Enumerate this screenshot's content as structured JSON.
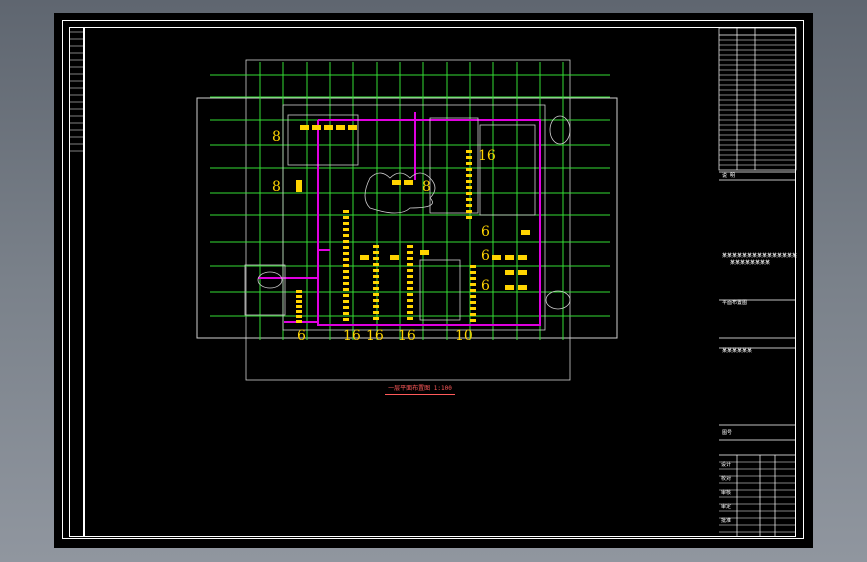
{
  "drawing": {
    "caption": "一层平面布置图 1:100",
    "zone_numbers_top": [
      "8",
      "8",
      "8",
      "16",
      "6",
      "6",
      "6"
    ],
    "zone_numbers_bottom": [
      "6",
      "16",
      "16",
      "16",
      "10"
    ]
  },
  "title_block": {
    "notes_heading": "说 明",
    "project_line_1": "某某某某某某某某某某某某某某某",
    "project_line_2": "某某某某某某某某",
    "drawing_name": "平面布置图",
    "drawing_number": "某某某某某某",
    "sheet_label": "图号",
    "rows": [
      "设计",
      "校对",
      "审核",
      "审定",
      "批准"
    ]
  },
  "colors": {
    "background": "#000000",
    "grid": "#33dd33",
    "walls": "#e000e0",
    "fixtures": "#ffd400",
    "linework": "#d9d9d9",
    "caption": "#ff5a5a"
  }
}
